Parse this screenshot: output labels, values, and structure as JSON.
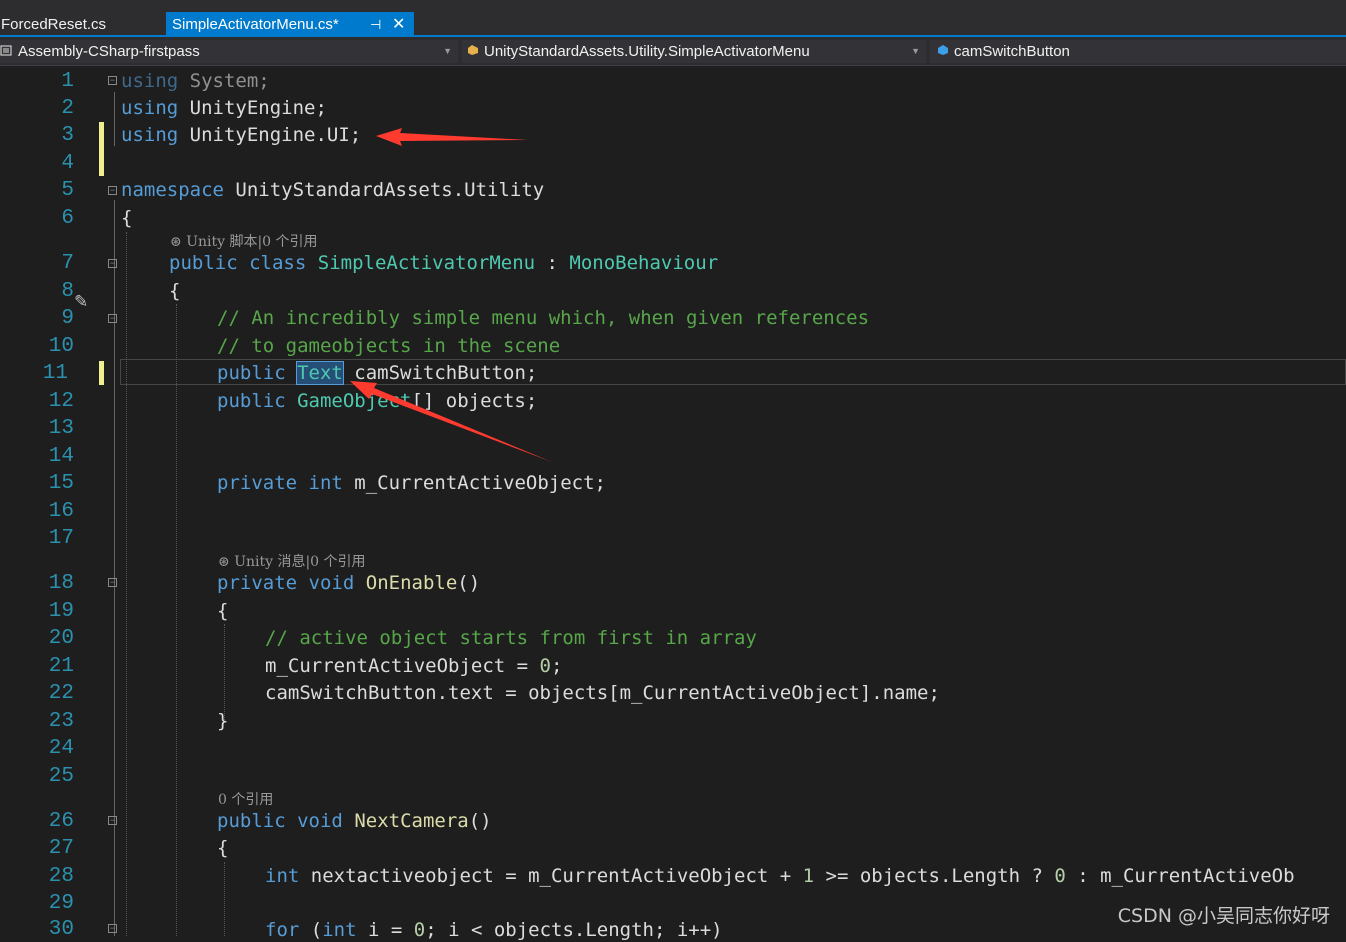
{
  "tabs": [
    {
      "label": "ForcedReset.cs",
      "active": false
    },
    {
      "label": "SimpleActivatorMenu.cs*",
      "active": true
    }
  ],
  "tab_pin_glyph": "⊣",
  "tab_close_glyph": "✕",
  "navbar": {
    "project": "Assembly-CSharp-firstpass",
    "type": "UnityStandardAssets.Utility.SimpleActivatorMenu",
    "member": "camSwitchButton"
  },
  "codelens": {
    "class": "Unity 脚本|0 个引用",
    "onenable": "Unity 消息|0 个引用",
    "nextcamera": "0 个引用"
  },
  "line_numbers": [
    "1",
    "2",
    "3",
    "4",
    "5",
    "6",
    "7",
    "8",
    "9",
    "10",
    "11",
    "12",
    "13",
    "14",
    "15",
    "16",
    "17",
    "18",
    "19",
    "20",
    "21",
    "22",
    "23",
    "24",
    "25",
    "26",
    "27",
    "28",
    "29",
    "30"
  ],
  "code": {
    "l1": [
      "using",
      " System;"
    ],
    "l2": [
      "using",
      " UnityEngine;"
    ],
    "l3": [
      "using",
      " UnityEngine.UI;"
    ],
    "l5": [
      "namespace",
      " UnityStandardAssets.Utility"
    ],
    "l6": "{",
    "l7": [
      "public",
      " ",
      "class",
      " ",
      "SimpleActivatorMenu",
      " : ",
      "MonoBehaviour"
    ],
    "l8": "{",
    "l9": "// An incredibly simple menu which, when given references",
    "l10": "// to gameobjects in the scene",
    "l11": [
      "public",
      " ",
      "Text",
      " camSwitchButton;"
    ],
    "l12": [
      "public",
      " ",
      "GameObject",
      "[] objects;"
    ],
    "l15": [
      "private",
      " ",
      "int",
      " m_CurrentActiveObject;"
    ],
    "l18": [
      "private",
      " ",
      "void",
      " ",
      "OnEnable",
      "()"
    ],
    "l19": "{",
    "l20": "// active object starts from first in array",
    "l21": [
      "m_CurrentActiveObject = ",
      "0",
      ";"
    ],
    "l22": "camSwitchButton.text = objects[m_CurrentActiveObject].name;",
    "l23": "}",
    "l26": [
      "public",
      " ",
      "void",
      " ",
      "NextCamera",
      "()"
    ],
    "l27": "{",
    "l28": [
      "int",
      " nextactiveobject = m_CurrentActiveObject + ",
      "1",
      " >= objects.Length ? ",
      "0",
      " : m_CurrentActiveOb"
    ],
    "l30": [
      "for",
      " (",
      "int",
      " i = ",
      "0",
      "; i < objects.Length; i++)"
    ]
  },
  "watermark": "CSDN @小吴同志你好呀",
  "colors": {
    "keyword": "#569cd6",
    "type": "#4ec9b0",
    "method": "#dcdcaa",
    "comment": "#57a64a",
    "number": "#b5cea8",
    "line_number": "#2b91af",
    "arrow": "#ff3b30",
    "accent": "#007acc"
  }
}
